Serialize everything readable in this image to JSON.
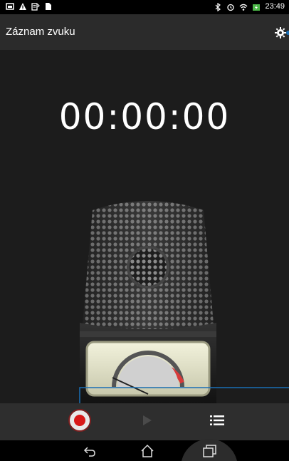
{
  "status_bar": {
    "time": "23:49",
    "left_icons": [
      "gallery-icon",
      "warning-icon",
      "wifi-data-icon",
      "document-icon"
    ],
    "right_icons": [
      "bluetooth-off-icon",
      "alarm-icon",
      "wifi-icon",
      "battery-charging-icon"
    ]
  },
  "app_bar": {
    "title": "Záznam zvuku",
    "settings_icon": "gear-icon"
  },
  "timer": {
    "value": "00:00:00"
  },
  "colors": {
    "background": "#1c1c1c",
    "app_bar": "#2b2b2b",
    "controls": "#2e2e2e",
    "record_red": "#d81818",
    "callout_blue": "#1a6fb5"
  },
  "controls": {
    "record_icon": "record-icon",
    "play_icon": "play-icon",
    "list_icon": "list-icon"
  },
  "nav_bar": {
    "icons": [
      "back-icon",
      "home-icon",
      "recent-apps-icon"
    ]
  }
}
